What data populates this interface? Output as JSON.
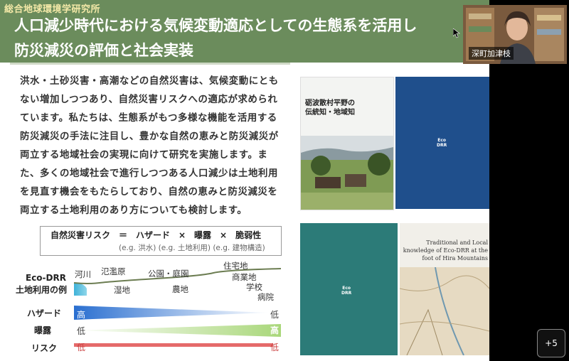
{
  "slide": {
    "org": "総合地球環境学研究所",
    "title_line1": "人口減少時代における気候変動適応としての生態系を活用し",
    "title_line2": "防災減災の評価と社会実装",
    "body_lines": [
      "洪水・土砂災害・高潮などの自然災害は、気候変動にとも",
      "ない増加しつつあり、自然災害リスクへの適応が求められ",
      "ています。私たちは、生態系がもつ多様な機能を活用する",
      "防災減災の手法に注目し、豊かな自然の恵みと防災減災が",
      "両立する地域社会の実現に向けて研究を実施します。ま",
      "た、多くの地域社会で進行しつつある人口減少は土地利用",
      "を見直す機会をもたらしており、自然の恵みと防災減災を",
      "両立する土地利用のあり方についても検討します。"
    ],
    "formula_main": "自然災害リスク　＝　ハザード　×　曝露　×　脆弱性",
    "formula_sub": "(e.g. 洪水) (e.g. 土地利用) (e.g. 建物構造)",
    "landuse_title_1": "Eco-DRR",
    "landuse_title_2": "土地利用の例",
    "landuse_labels": [
      "河川",
      "氾濫原",
      "湿地",
      "公園・庭園",
      "農地",
      "住宅地",
      "商業地",
      "学校",
      "病院"
    ],
    "hazard_label": "ハザード",
    "exposure_label": "曝露",
    "risk_label": "リスク",
    "hazard_left": "高",
    "hazard_right": "低",
    "exposure_left": "低",
    "exposure_right": "高",
    "risk_left": "低",
    "risk_right": "低",
    "book1_title_1": "砺波散村平野の",
    "book1_title_2": "伝統知・地域知",
    "book_eco_1": "Eco",
    "book_eco_2": "DRR",
    "book4_title": "Traditional and Local knowledge of Eco-DRR at the foot of Hira Mountains"
  },
  "webcam": {
    "name": "深町加津枝"
  },
  "more_button": "+5",
  "colors": {
    "header": "#6b8c5c",
    "org_text": "#f4e9a8",
    "hazard": "#3a7bd5",
    "exposure": "#b6dc8c",
    "risk": "#e56a6a"
  }
}
